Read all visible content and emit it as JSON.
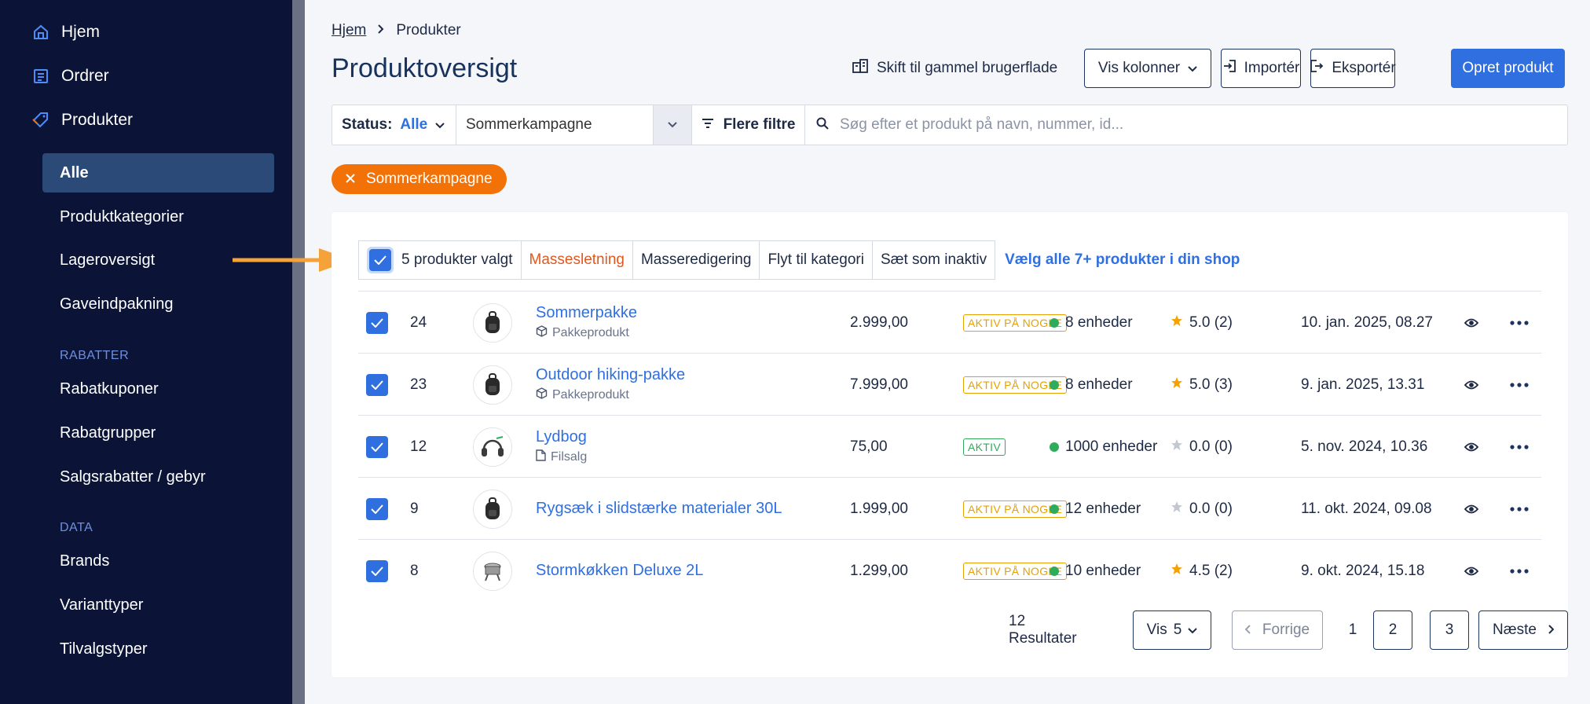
{
  "sidebar": {
    "top_items": [
      {
        "label": "Hjem",
        "icon": "home-icon"
      },
      {
        "label": "Ordrer",
        "icon": "orders-icon"
      },
      {
        "label": "Produkter",
        "icon": "tag-icon"
      }
    ],
    "product_items": [
      "Alle",
      "Produktkategorier",
      "Lageroversigt",
      "Gaveindpakning"
    ],
    "section_rabatter": "RABATTER",
    "rabat_items": [
      "Rabatkuponer",
      "Rabatgrupper",
      "Salgsrabatter / gebyr"
    ],
    "section_data": "DATA",
    "data_items": [
      "Brands",
      "Varianttyper",
      "Tilvalgstyper"
    ]
  },
  "breadcrumb": {
    "home": "Hjem",
    "current": "Produkter"
  },
  "page_title": "Produktoversigt",
  "toolbar": {
    "switch_ui": "Skift til gammel brugerflade",
    "columns": "Vis kolonner",
    "import": "Importér",
    "export": "Eksportér",
    "create": "Opret produkt"
  },
  "filters": {
    "status_label": "Status:",
    "status_value": "Alle",
    "campaign_value": "Sommerkampagne",
    "more_filters": "Flere filtre",
    "search_placeholder": "Søg efter et produkt på navn, nummer, id..."
  },
  "active_chip": "Sommerkampagne",
  "bulk": {
    "selected": "5 produkter valgt",
    "delete": "Massesletning",
    "edit": "Masseredigering",
    "move": "Flyt til kategori",
    "inactive": "Sæt som inaktiv",
    "select_all": "Vælg alle 7+ produkter i din shop"
  },
  "products": [
    {
      "id": "24",
      "name": "Sommerpakke",
      "subtype": "Pakkeprodukt",
      "subtype_icon": "package-icon",
      "image": "backpack",
      "price": "2.999,00",
      "status": "AKTIV PÅ NOGLE",
      "status_kind": "partial",
      "stock": "8 enheder",
      "rating": "5.0 (2)",
      "rated": true,
      "date": "10. jan. 2025, 08.27"
    },
    {
      "id": "23",
      "name": "Outdoor hiking-pakke",
      "subtype": "Pakkeprodukt",
      "subtype_icon": "package-icon",
      "image": "backpack",
      "price": "7.999,00",
      "status": "AKTIV PÅ NOGLE",
      "status_kind": "partial",
      "stock": "8 enheder",
      "rating": "5.0 (3)",
      "rated": true,
      "date": "9. jan. 2025, 13.31"
    },
    {
      "id": "12",
      "name": "Lydbog",
      "subtype": "Filsalg",
      "subtype_icon": "file-icon",
      "image": "headphones",
      "price": "75,00",
      "status": "AKTIV",
      "status_kind": "active",
      "stock": "1000 enheder",
      "rating": "0.0 (0)",
      "rated": false,
      "date": "5. nov. 2024, 10.36"
    },
    {
      "id": "9",
      "name": "Rygsæk i slidstærke materialer 30L",
      "subtype": "",
      "subtype_icon": "",
      "image": "backpack",
      "price": "1.999,00",
      "status": "AKTIV PÅ NOGLE",
      "status_kind": "partial",
      "stock": "12 enheder",
      "rating": "0.0 (0)",
      "rated": false,
      "date": "11. okt. 2024, 09.08"
    },
    {
      "id": "8",
      "name": "Stormkøkken Deluxe 2L",
      "subtype": "",
      "subtype_icon": "",
      "image": "stove",
      "price": "1.299,00",
      "status": "AKTIV PÅ NOGLE",
      "status_kind": "partial",
      "stock": "10 enheder",
      "rating": "4.5 (2)",
      "rated": true,
      "date": "9. okt. 2024, 15.18"
    }
  ],
  "pagination": {
    "results": "12 Resultater",
    "show_label": "Vis",
    "show_value": "5",
    "prev": "Forrige",
    "pages": [
      "1",
      "2",
      "3"
    ],
    "next": "Næste"
  },
  "colors": {
    "accent": "#2f6fe0",
    "sidebar": "#0b1437",
    "chip": "#f27208",
    "warning": "#e6a100",
    "success": "#2eac5c",
    "arrow": "#f5a23a"
  }
}
